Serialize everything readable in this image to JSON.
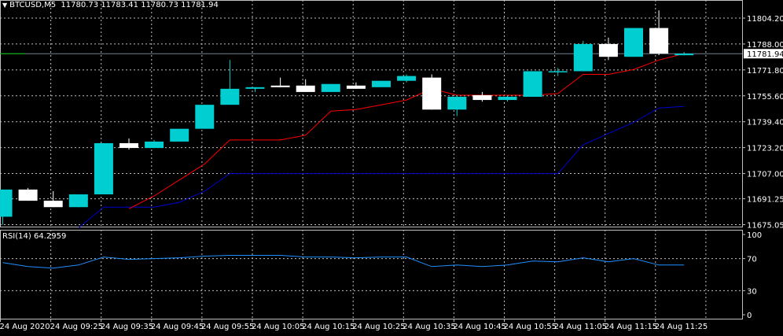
{
  "header": {
    "symbol": "BTCUSD,M5",
    "ohlc": "11780.73 11783.41 11780.73 11781.94"
  },
  "rsi_header": {
    "label": "RSI(14)",
    "value": "64.2959"
  },
  "price_axis_labels": [
    "11804.20",
    "11788.00",
    "11771.80",
    "11755.60",
    "11739.40",
    "11723.20",
    "11707.00",
    "11691.25",
    "11675.05"
  ],
  "rsi_axis_labels": [
    "100",
    "70",
    "30",
    "0"
  ],
  "time_labels": [
    "24 Aug 2020",
    "24 Aug 09:25",
    "24 Aug 09:35",
    "24 Aug 09:45",
    "24 Aug 09:55",
    "24 Aug 10:05",
    "24 Aug 10:15",
    "24 Aug 10:25",
    "24 Aug 10:35",
    "24 Aug 10:45",
    "24 Aug 10:55",
    "24 Aug 11:05",
    "24 Aug 11:15",
    "24 Aug 11:25"
  ],
  "current_price_label": "11781.94",
  "colors": {
    "background": "#000000",
    "grid": "#c0c0c0",
    "bull_candle": "#00ced1",
    "bear_candle": "#ffffff",
    "red_line": "#ff0000",
    "blue_line": "#0000cd",
    "rsi_line": "#1e90ff",
    "price_line": "#708090"
  },
  "chart_data": {
    "type": "candlestick",
    "symbol": "BTCUSD",
    "timeframe": "M5",
    "ylim": [
      11675.05,
      11810
    ],
    "candles": [
      {
        "o": 11680,
        "h": 11697,
        "l": 11675,
        "c": 11697
      },
      {
        "o": 11697,
        "h": 11698,
        "l": 11690,
        "c": 11690
      },
      {
        "o": 11690,
        "h": 11696,
        "l": 11686,
        "c": 11686
      },
      {
        "o": 11686,
        "h": 11694,
        "l": 11686,
        "c": 11694
      },
      {
        "o": 11694,
        "h": 11726,
        "l": 11694,
        "c": 11726
      },
      {
        "o": 11726,
        "h": 11729,
        "l": 11722,
        "c": 11723
      },
      {
        "o": 11723,
        "h": 11728,
        "l": 11723,
        "c": 11727
      },
      {
        "o": 11727,
        "h": 11735,
        "l": 11727,
        "c": 11735
      },
      {
        "o": 11735,
        "h": 11750,
        "l": 11735,
        "c": 11750
      },
      {
        "o": 11750,
        "h": 11778,
        "l": 11750,
        "c": 11760
      },
      {
        "o": 11760,
        "h": 11761,
        "l": 11758,
        "c": 11761
      },
      {
        "o": 11762,
        "h": 11767,
        "l": 11761,
        "c": 11761
      },
      {
        "o": 11762,
        "h": 11766,
        "l": 11758,
        "c": 11758
      },
      {
        "o": 11758,
        "h": 11763,
        "l": 11758,
        "c": 11763
      },
      {
        "o": 11762,
        "h": 11764,
        "l": 11760,
        "c": 11760
      },
      {
        "o": 11761,
        "h": 11765,
        "l": 11761,
        "c": 11765
      },
      {
        "o": 11765,
        "h": 11769,
        "l": 11764,
        "c": 11768
      },
      {
        "o": 11767,
        "h": 11769,
        "l": 11747,
        "c": 11747
      },
      {
        "o": 11747,
        "h": 11756,
        "l": 11743,
        "c": 11755
      },
      {
        "o": 11756,
        "h": 11758,
        "l": 11752,
        "c": 11753
      },
      {
        "o": 11753,
        "h": 11756,
        "l": 11752,
        "c": 11755
      },
      {
        "o": 11755,
        "h": 11771,
        "l": 11755,
        "c": 11771
      },
      {
        "o": 11771,
        "h": 11773,
        "l": 11768,
        "c": 11771
      },
      {
        "o": 11771,
        "h": 11790,
        "l": 11771,
        "c": 11788
      },
      {
        "o": 11788,
        "h": 11792,
        "l": 11778,
        "c": 11780
      },
      {
        "o": 11780,
        "h": 11798,
        "l": 11780,
        "c": 11798
      },
      {
        "o": 11798,
        "h": 11809,
        "l": 11781,
        "c": 11782
      },
      {
        "o": 11781,
        "h": 11783,
        "l": 11781,
        "c": 11782
      }
    ],
    "red_line": [
      null,
      null,
      null,
      null,
      null,
      11685,
      11693,
      11703,
      11713,
      11728,
      11728,
      11728,
      11731,
      11746,
      11747,
      11750,
      11753,
      11760,
      11756,
      11756,
      11756,
      11756,
      11757,
      11769,
      11769,
      11772,
      11778,
      11782
    ],
    "blue_line": [
      null,
      null,
      null,
      11673,
      11686,
      11686,
      11686,
      11689,
      11696,
      11707,
      11707,
      11707,
      11707,
      11707,
      11707,
      11707,
      11707,
      11707,
      11707,
      11707,
      11707,
      11707,
      11707,
      11725,
      11732,
      11739,
      11748,
      11749
    ],
    "rsi": {
      "period": 14,
      "current": 64.2959,
      "ylim": [
        0,
        100
      ],
      "levels": [
        30,
        70
      ],
      "values": [
        65,
        60,
        58,
        62,
        72,
        69,
        70,
        71,
        73,
        74,
        74,
        74,
        72,
        72,
        71,
        72,
        72,
        60,
        62,
        60,
        62,
        67,
        66,
        71,
        66,
        70,
        62,
        62
      ]
    }
  }
}
